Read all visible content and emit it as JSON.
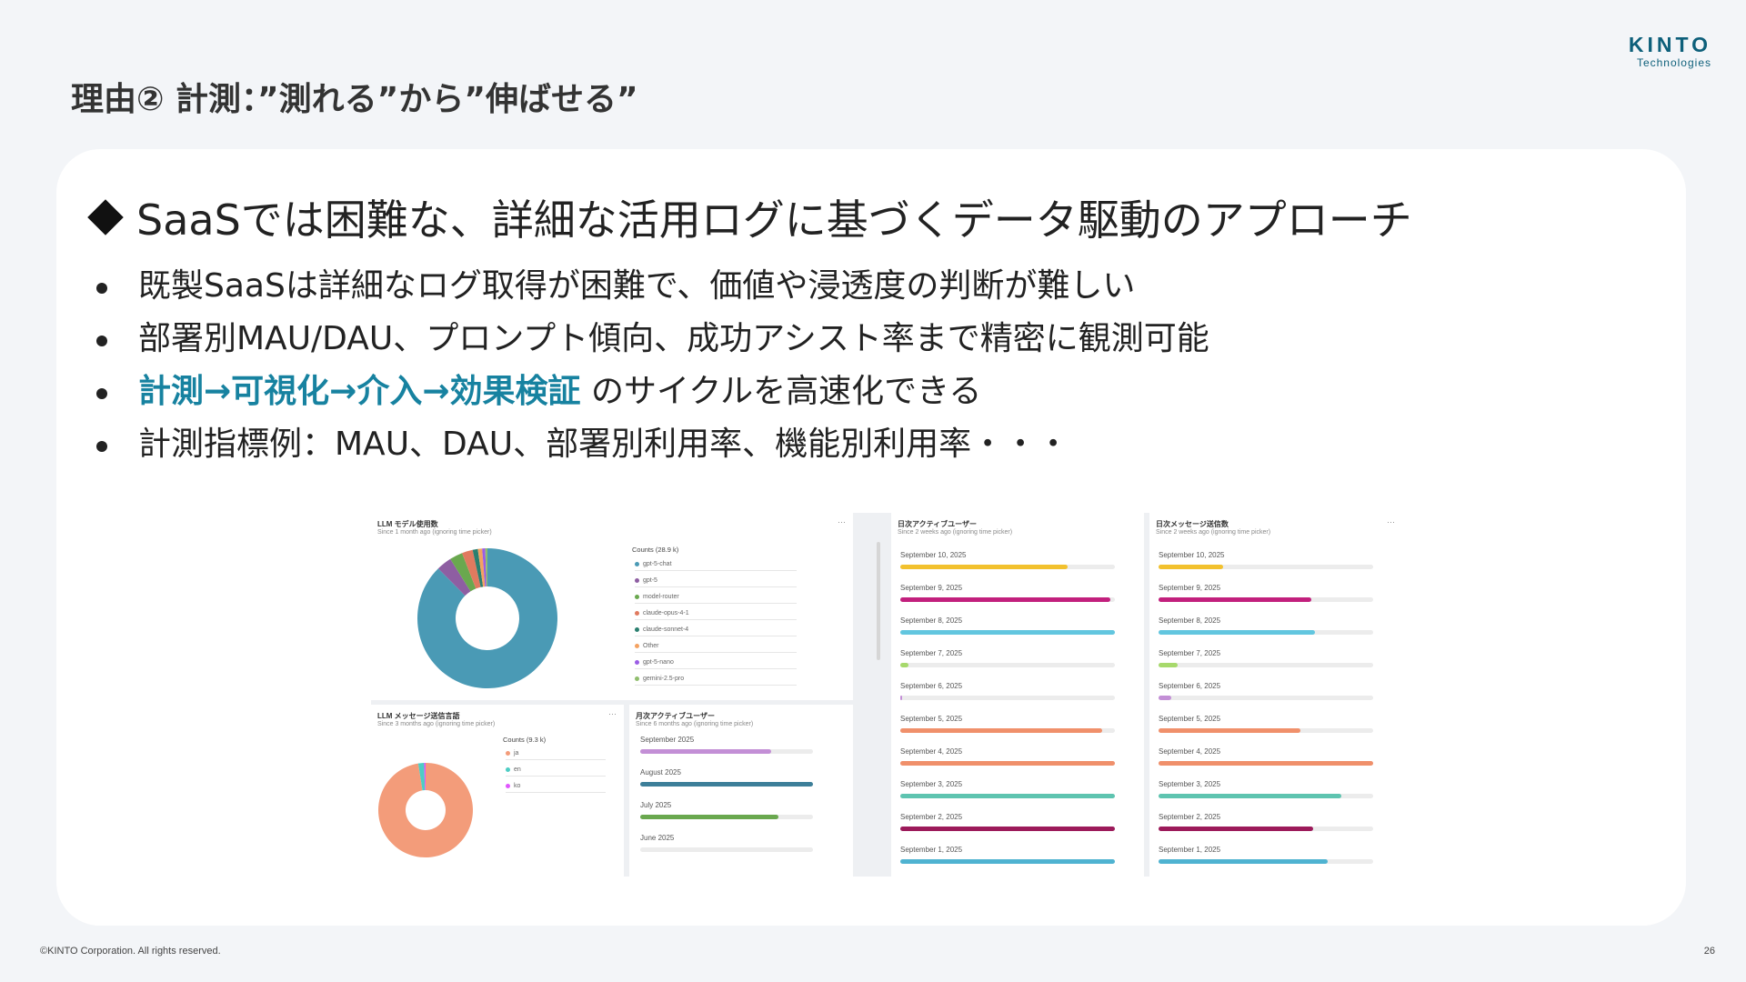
{
  "logo": {
    "name": "KINTO",
    "sub": "Technologies"
  },
  "slide_title": "理由② 計測：”測れる”から”伸ばせる”",
  "heading": "SaaSでは困難な、詳細な活用ログに基づくデータ駆動のアプローチ",
  "bullets": [
    {
      "text": "既製SaaSは詳細なログ取得が困難で、価値や浸透度の判断が難しい"
    },
    {
      "text": "部署別MAU/DAU、プロンプト傾向、成功アシスト率まで精密に観測可能"
    },
    {
      "highlight": "計測→可視化→介入→効果検証",
      "text": " のサイクルを高速化できる"
    },
    {
      "text": "計測指標例：MAU、DAU、部署別利用率、機能別利用率・・・"
    }
  ],
  "footer": "©KINTO Corporation. All rights reserved.",
  "page_number": "26",
  "dashboard": {
    "llm_models": {
      "title": "LLM モデル使用数",
      "subtitle": "Since 1 month ago (ignoring time picker)",
      "more": "···",
      "legend_title": "Counts (28.9 k)",
      "legend": [
        {
          "label": "gpt-5-chat",
          "color": "#4a9ab5"
        },
        {
          "label": "gpt-5",
          "color": "#8e5ea2"
        },
        {
          "label": "model-router",
          "color": "#6aa84f"
        },
        {
          "label": "claude-opus-4-1",
          "color": "#e07a5f"
        },
        {
          "label": "claude-sonnet-4",
          "color": "#2a7f6f"
        },
        {
          "label": "Other",
          "color": "#f4a261"
        },
        {
          "label": "gpt-5-nano",
          "color": "#9b5de5"
        },
        {
          "label": "gemini-2.5-pro",
          "color": "#90be6d"
        }
      ]
    },
    "llm_languages": {
      "title": "LLM メッセージ送信言語",
      "subtitle": "Since 3 months ago (ignoring time picker)",
      "more": "···",
      "legend_title": "Counts (9.3 k)",
      "legend": [
        {
          "label": "ja",
          "color": "#f39c7a"
        },
        {
          "label": "en",
          "color": "#4ecdc4"
        },
        {
          "label": "ko",
          "color": "#e056fd"
        }
      ]
    },
    "monthly_active": {
      "title": "月次アクティブユーザー",
      "subtitle": "Since 6 months ago (ignoring time picker)",
      "rows": [
        {
          "label": "September 2025",
          "value": 0.76,
          "color": "#c38fd6"
        },
        {
          "label": "August 2025",
          "value": 1.0,
          "color": "#3d7f99"
        },
        {
          "label": "July 2025",
          "value": 0.8,
          "color": "#6aa84f"
        },
        {
          "label": "June 2025",
          "value": 0.0,
          "color": "#cccccc"
        }
      ]
    },
    "daily_active": {
      "title": "日次アクティブユーザー",
      "subtitle": "Since 2 weeks ago (ignoring time picker)",
      "rows": [
        {
          "label": "September 10, 2025",
          "value": 0.78,
          "color": "#f2c12e"
        },
        {
          "label": "September 9, 2025",
          "value": 0.98,
          "color": "#c2207d"
        },
        {
          "label": "September 8, 2025",
          "value": 1.0,
          "color": "#62c6df"
        },
        {
          "label": "September 7, 2025",
          "value": 0.04,
          "color": "#a7d96c"
        },
        {
          "label": "September 6, 2025",
          "value": 0.01,
          "color": "#c38fd6"
        },
        {
          "label": "September 5, 2025",
          "value": 0.94,
          "color": "#f0906b"
        },
        {
          "label": "September 4, 2025",
          "value": 1.0,
          "color": "#f0906b"
        },
        {
          "label": "September 3, 2025",
          "value": 1.0,
          "color": "#5ec4b0"
        },
        {
          "label": "September 2, 2025",
          "value": 1.0,
          "color": "#9c1a5a"
        },
        {
          "label": "September 1, 2025",
          "value": 1.0,
          "color": "#4fb3d1"
        }
      ]
    },
    "daily_messages": {
      "title": "日次メッセージ送信数",
      "subtitle": "Since 2 weeks ago (ignoring time picker)",
      "more": "···",
      "rows": [
        {
          "label": "September 10, 2025",
          "value": 0.3,
          "color": "#f2c12e"
        },
        {
          "label": "September 9, 2025",
          "value": 0.71,
          "color": "#c2207d"
        },
        {
          "label": "September 8, 2025",
          "value": 0.73,
          "color": "#62c6df"
        },
        {
          "label": "September 7, 2025",
          "value": 0.09,
          "color": "#a7d96c"
        },
        {
          "label": "September 6, 2025",
          "value": 0.06,
          "color": "#c38fd6"
        },
        {
          "label": "September 5, 2025",
          "value": 0.66,
          "color": "#f0906b"
        },
        {
          "label": "September 4, 2025",
          "value": 1.0,
          "color": "#f0906b"
        },
        {
          "label": "September 3, 2025",
          "value": 0.85,
          "color": "#5ec4b0"
        },
        {
          "label": "September 2, 2025",
          "value": 0.72,
          "color": "#9c1a5a"
        },
        {
          "label": "September 1, 2025",
          "value": 0.79,
          "color": "#4fb3d1"
        }
      ]
    }
  },
  "chart_data": [
    {
      "type": "pie",
      "title": "LLM モデル使用数",
      "categories": [
        "gpt-5-chat",
        "gpt-5",
        "model-router",
        "claude-opus-4-1",
        "claude-sonnet-4",
        "Other",
        "gpt-5-nano",
        "gemini-2.5-pro"
      ],
      "values": [
        87.6,
        3.5,
        3.0,
        2.5,
        1.2,
        1.0,
        0.7,
        0.5
      ],
      "legend_title": "Counts (28.9 k)"
    },
    {
      "type": "pie",
      "title": "LLM メッセージ送信言語",
      "categories": [
        "ja",
        "en",
        "ko"
      ],
      "values": [
        97.5,
        2.0,
        0.5
      ],
      "legend_title": "Counts (9.3 k)"
    },
    {
      "type": "bar",
      "title": "月次アクティブユーザー",
      "categories": [
        "September 2025",
        "August 2025",
        "July 2025",
        "June 2025"
      ],
      "values": [
        0.76,
        1.0,
        0.8,
        0.0
      ]
    },
    {
      "type": "bar",
      "title": "日次アクティブユーザー",
      "categories": [
        "September 10, 2025",
        "September 9, 2025",
        "September 8, 2025",
        "September 7, 2025",
        "September 6, 2025",
        "September 5, 2025",
        "September 4, 2025",
        "September 3, 2025",
        "September 2, 2025",
        "September 1, 2025"
      ],
      "values": [
        0.78,
        0.98,
        1.0,
        0.04,
        0.01,
        0.94,
        1.0,
        1.0,
        1.0,
        1.0
      ]
    },
    {
      "type": "bar",
      "title": "日次メッセージ送信数",
      "categories": [
        "September 10, 2025",
        "September 9, 2025",
        "September 8, 2025",
        "September 7, 2025",
        "September 6, 2025",
        "September 5, 2025",
        "September 4, 2025",
        "September 3, 2025",
        "September 2, 2025",
        "September 1, 2025"
      ],
      "values": [
        0.3,
        0.71,
        0.73,
        0.09,
        0.06,
        0.66,
        1.0,
        0.85,
        0.72,
        0.79
      ]
    }
  ]
}
